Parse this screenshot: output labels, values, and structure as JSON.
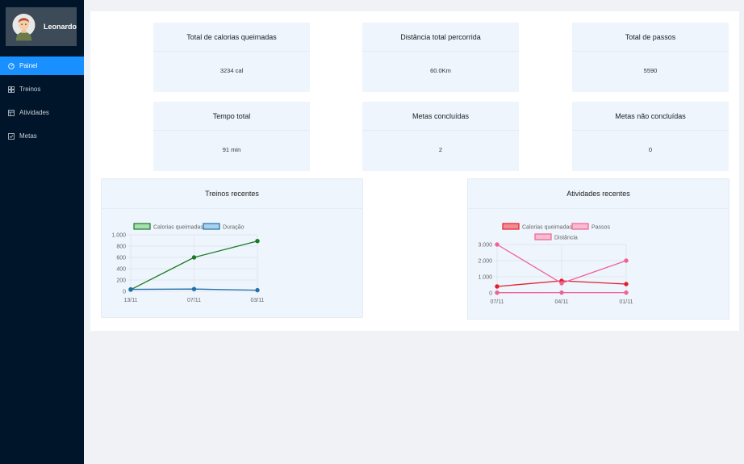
{
  "user": {
    "name": "Leonardo"
  },
  "nav": {
    "items": [
      {
        "label": "Painel",
        "icon": "dashboard-icon"
      },
      {
        "label": "Treinos",
        "icon": "grid-icon"
      },
      {
        "label": "Atividades",
        "icon": "calendar-icon"
      },
      {
        "label": "Metas",
        "icon": "check-square-icon"
      }
    ],
    "active_index": 0
  },
  "stats": [
    {
      "title": "Total de calorias queimadas",
      "value": "3234 cal"
    },
    {
      "title": "Distância total percorrida",
      "value": "60.0Km"
    },
    {
      "title": "Total de passos",
      "value": "5590"
    },
    {
      "title": "Tempo total",
      "value": "91 min"
    },
    {
      "title": "Metas concluídas",
      "value": "2"
    },
    {
      "title": "Metas não concluídas",
      "value": "0"
    }
  ],
  "colors": {
    "sidebar": "#001529",
    "accent": "#1890ff",
    "card": "#eef5fd"
  },
  "chart_data": [
    {
      "type": "line",
      "title": "Treinos recentes",
      "categories": [
        "13/11",
        "07/11",
        "03/11"
      ],
      "series": [
        {
          "name": "Calorias queimadas",
          "values": [
            30,
            600,
            890
          ],
          "color": "#1a7a22",
          "fill": "#a6e0b0"
        },
        {
          "name": "Duração",
          "values": [
            35,
            40,
            20
          ],
          "color": "#2270a8",
          "fill": "#a9d0ec"
        }
      ],
      "ylim": [
        0,
        1000
      ],
      "yticks": [
        0,
        200,
        400,
        600,
        800,
        1000
      ],
      "ytick_labels": [
        "0",
        "200",
        "400",
        "600",
        "800",
        "1.000"
      ],
      "grid": true,
      "legend": "top"
    },
    {
      "type": "line",
      "title": "Atividades recentes",
      "categories": [
        "07/11",
        "04/11",
        "01/11"
      ],
      "series": [
        {
          "name": "Calorias queimadas",
          "values": [
            400,
            750,
            550
          ],
          "color": "#e0202a",
          "fill": "#f48a90"
        },
        {
          "name": "Passos",
          "values": [
            3000,
            600,
            2000
          ],
          "color": "#f06292",
          "fill": "#f8bbd0"
        },
        {
          "name": "Distância",
          "values": [
            15,
            20,
            20
          ],
          "color": "#f06292",
          "fill": "#f8bbd0"
        }
      ],
      "ylim": [
        0,
        3000
      ],
      "yticks": [
        0,
        1000,
        2000,
        3000
      ],
      "ytick_labels": [
        "0",
        "1.000",
        "2.000",
        "3.000"
      ],
      "grid": true,
      "legend": "top"
    }
  ]
}
